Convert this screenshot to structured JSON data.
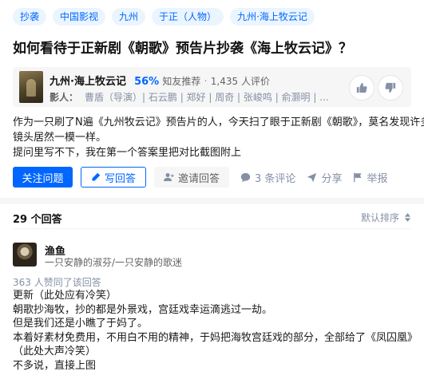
{
  "question": {
    "topics": [
      "抄袭",
      "中国影视",
      "九州",
      "于正（人物）",
      "九州·海上牧云记"
    ],
    "title": "如何看待于正新剧《朝歌》预告片抄袭《海上牧云记》？",
    "reference": {
      "name": "九州·海上牧云记",
      "percent": "56%",
      "recommend_label": "知友推荐",
      "separator": "·",
      "ratings": "1,435 人评价",
      "cast_label": "影人：",
      "cast": "曹盾（导演）| 石云鹏 | 郑好 | 周奇 | 张峻鸣 | 俞灏明 | ..."
    },
    "description": [
      "作为一只刷了N遍《九州牧云记》预告片的人，今天扫了眼于正新剧《朝歌》，莫名发现许多",
      "镜头居然一模一样。",
      "提问里写不下，我在第一个答案里把对比截图附上"
    ],
    "actions": {
      "follow": "关注问题",
      "write": "写回答",
      "invite": "邀请回答",
      "comments": "3 条评论",
      "share": "分享",
      "report": "举报"
    }
  },
  "answers": {
    "count": "29 个回答",
    "sort": "默认排序",
    "first": {
      "author": "渔鱼",
      "bio": "一只安静的淑芬/一只安静的歌迷",
      "votes": "363 人赞同了该回答",
      "body": [
        "更新（此处应有冷笑）",
        "朝歌抄海牧，抄的都是外景戏，宫廷戏幸运滴逃过一劫。",
        "但是我们还是小瞧了于妈了。",
        "本着好素材免费用，不用白不用的精神，于妈把海牧宫廷戏的部分，全部给了《凤囚凰》",
        "（此处大声冷笑）",
        "不多说，直接上图"
      ]
    }
  },
  "colors": {
    "accent": "#0066ff",
    "tag_bg": "#ebf5ff",
    "muted": "#8590a6"
  }
}
